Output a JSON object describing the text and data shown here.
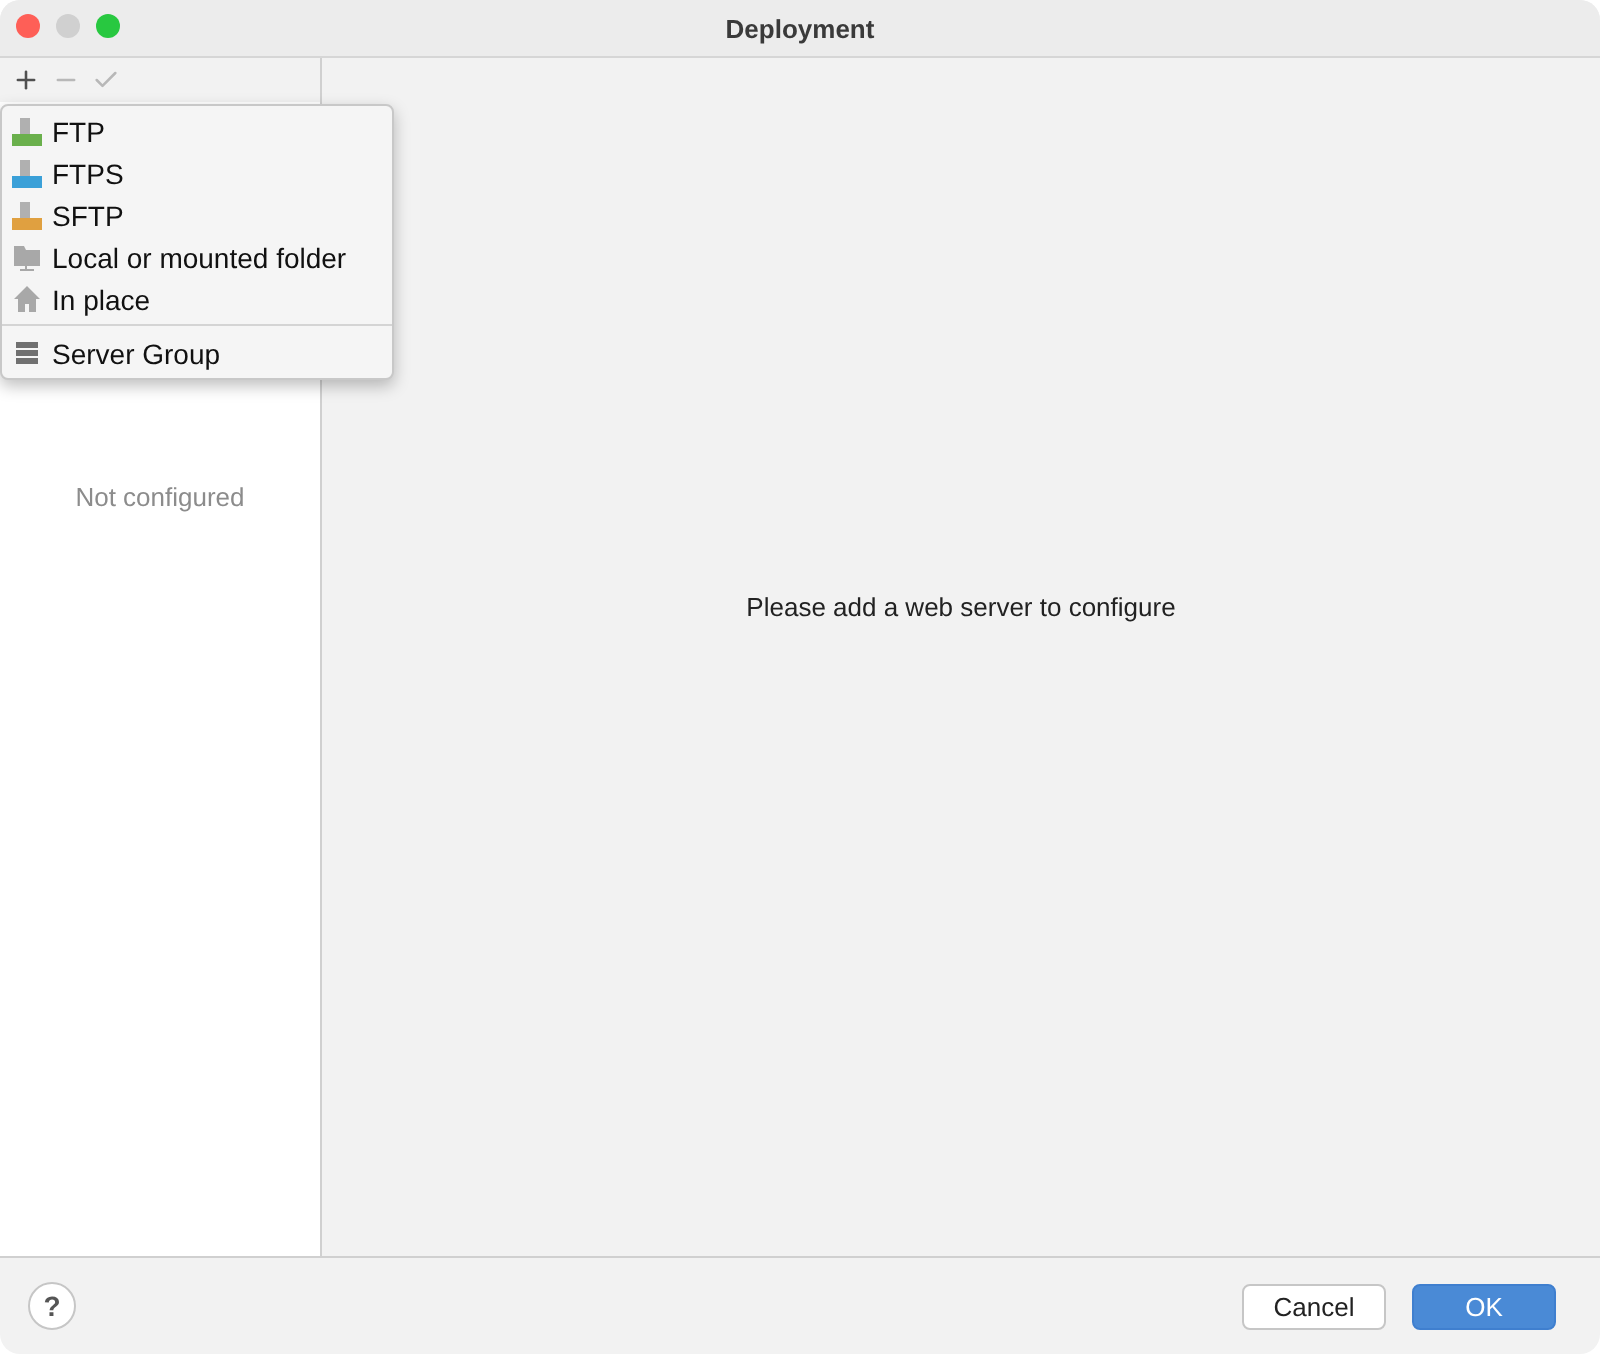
{
  "window": {
    "title": "Deployment"
  },
  "toolbar": [
    {
      "kind": "add",
      "disabled": false
    },
    {
      "kind": "remove",
      "disabled": true
    },
    {
      "kind": "apply",
      "disabled": true
    }
  ],
  "add_menu": {
    "items": [
      {
        "label": "FTP",
        "kind": "ftp",
        "separator_before": false
      },
      {
        "label": "FTPS",
        "kind": "ftps",
        "separator_before": false
      },
      {
        "label": "SFTP",
        "kind": "sftp",
        "separator_before": false
      },
      {
        "label": "Local or mounted folder",
        "kind": "folder",
        "separator_before": false
      },
      {
        "label": "In place",
        "kind": "home",
        "separator_before": false
      },
      {
        "label": "Server Group",
        "kind": "group",
        "separator_before": true
      }
    ]
  },
  "sidebar": {
    "empty_text": "Not configured"
  },
  "main": {
    "empty_text": "Please add a web server to configure"
  },
  "footer": {
    "help": "?",
    "buttons": [
      {
        "label": "Cancel",
        "kind": "secondary"
      },
      {
        "label": "OK",
        "kind": "primary"
      }
    ]
  }
}
